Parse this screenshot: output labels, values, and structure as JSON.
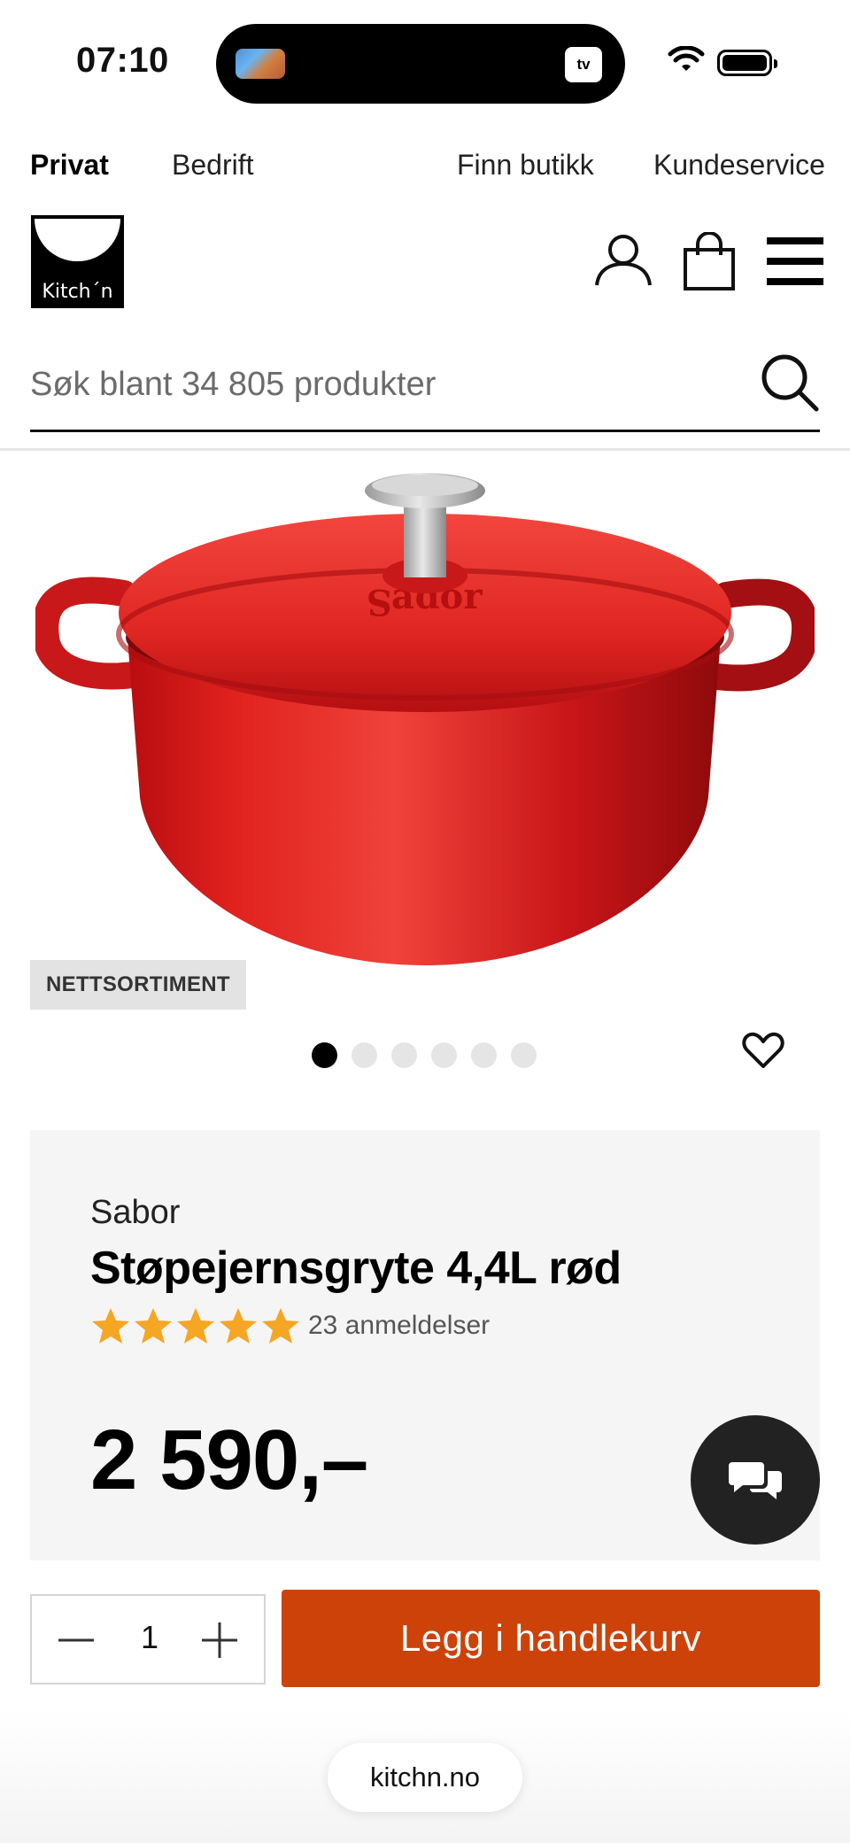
{
  "status_bar": {
    "time": "07:10",
    "island_app": "tv"
  },
  "top_nav": {
    "privat": "Privat",
    "bedrift": "Bedrift",
    "finn_butikk": "Finn butikk",
    "kundeservice": "Kundeservice"
  },
  "header": {
    "logo_text": "Kitch´n"
  },
  "search": {
    "placeholder": "Søk blant 34 805 produkter"
  },
  "product": {
    "badge": "NETTSORTIMENT",
    "image_count": 6,
    "active_image": 1,
    "brand": "Sabor",
    "title": "Støpejernsgryte 4,4L rød",
    "rating": 5,
    "reviews": "23 anmeldelser",
    "price": "2 590,–"
  },
  "cart": {
    "quantity": "1",
    "add_label": "Legg i handlekurv"
  },
  "browser": {
    "url": "kitchn.no"
  },
  "colors": {
    "accent": "#cc4208",
    "card_bg": "#f5f5f5",
    "star": "#f5a623",
    "chat_bg": "#222222",
    "pot_red": "#d9191c"
  },
  "icons": [
    "user-icon",
    "shopping-bag-icon",
    "menu-icon",
    "search-icon",
    "heart-icon",
    "chat-icon",
    "minus-icon",
    "plus-icon",
    "star-icon"
  ]
}
